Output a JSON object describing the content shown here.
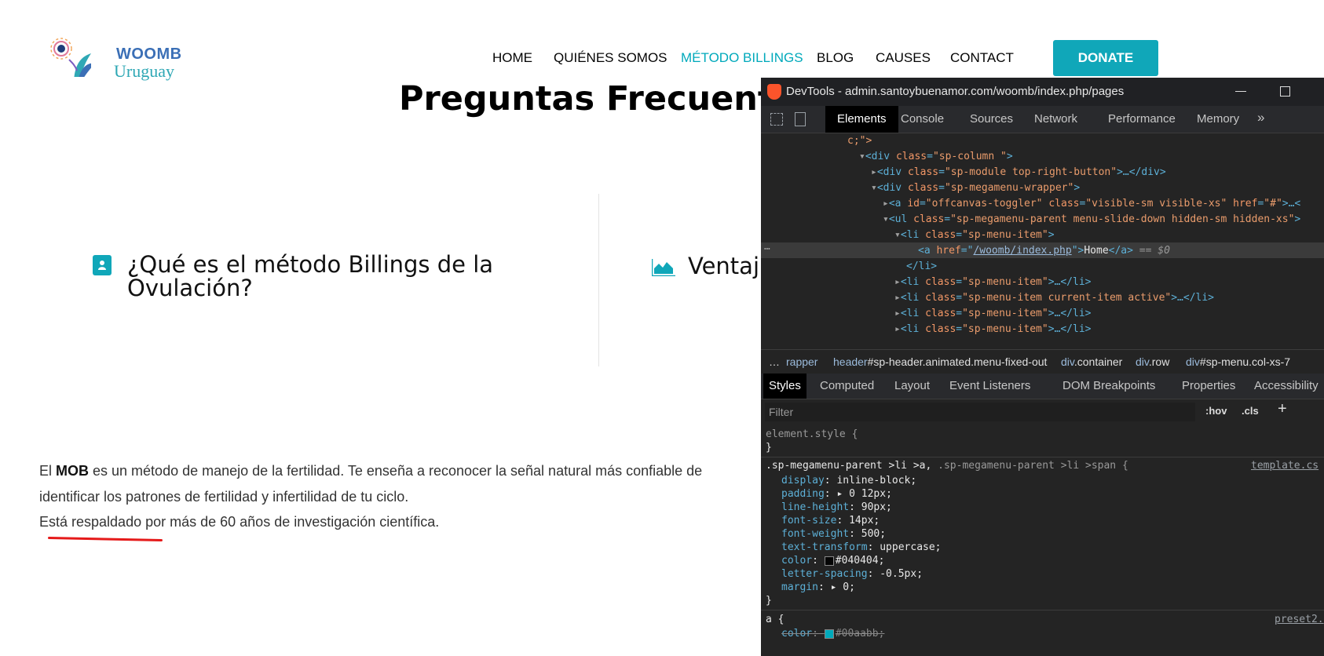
{
  "site": {
    "logo": {
      "line1": "WOOMB",
      "line2": "Uruguay"
    },
    "nav": [
      "HOME",
      "QUIÉNES SOMOS",
      "MÉTODO BILLINGS",
      "BLOG",
      "CAUSES",
      "CONTACT"
    ],
    "donate": "DONATE",
    "page_title": "Preguntas Frecuentes",
    "faq": [
      {
        "line1": "¿Qué es el método Billings de la",
        "line2": "Ovulación?"
      },
      {
        "line1": "Ventaj"
      }
    ],
    "paragraph": {
      "line1_a": "El ",
      "line1_bold": "MOB",
      "line1_b": " es un método de manejo de la fertilidad. Te enseña a reconocer la señal natural más confiable de",
      "line2": "identificar los patrones de fertilidad y infertilidad de tu ciclo.",
      "line3": "Está respaldado por más de 60 años de investigación científica."
    },
    "colors": {
      "accent": "#00a9bb",
      "donate_bg": "#10a7b9"
    }
  },
  "devtools": {
    "title": "DevTools - admin.santoybuenamor.com/woomb/index.php/pages",
    "tabs": [
      "Elements",
      "Console",
      "Sources",
      "Network",
      "Performance",
      "Memory"
    ],
    "more": "»",
    "dom": {
      "l0": "c;\">",
      "l1_tag": "<div ",
      "l1_attr": "class",
      "l1_val": "\"sp-column \"",
      "l1_end": ">",
      "l2_tag": "<div ",
      "l2_attr": "class",
      "l2_val": "\"sp-module top-right-button\"",
      "l2_end": ">…</div>",
      "l3_tag": "<div ",
      "l3_attr": "class",
      "l3_val": "\"sp-megamenu-wrapper\"",
      "l3_end": ">",
      "l4_tag": "<a ",
      "l4_attr": "id",
      "l4_val": "\"offcanvas-toggler\"",
      "l4_attr2": " class",
      "l4_val2": "\"visible-sm visible-xs\"",
      "l4_attr3": " href",
      "l4_val3": "\"#\"",
      "l4_end": ">…<",
      "l5_tag": "<ul ",
      "l5_attr": "class",
      "l5_val": "\"sp-megamenu-parent menu-slide-down hidden-sm hidden-xs\"",
      "l5_end": ">",
      "l6_tag": "<li ",
      "l6_attr": "class",
      "l6_val": "\"sp-menu-item\"",
      "l6_end": ">",
      "l7_tag": "<a ",
      "l7_attr": "href",
      "l7_q1": "=\"",
      "l7_link": "/woomb/index.php",
      "l7_q2": "\">",
      "l7_text": "Home",
      "l7_end": "</a>",
      "l7_eq": " == $0",
      "l8": "</li>",
      "l9_val": "\"sp-menu-item\"",
      "l9_end": ">…</li>",
      "l10_val": "\"sp-menu-item current-item active\"",
      "l10_end": ">…</li>",
      "l11_val": "\"sp-menu-item\"",
      "l11_end": ">…</li>",
      "l12_val": "\"sp-menu-item\"",
      "l12_end": ">…</li>"
    },
    "breadcrumbs": {
      "dots": "…",
      "c1": "rapper",
      "c2_tag": "header",
      "c2_rest": "#sp-header.animated.menu-fixed-out",
      "c3_tag": "div",
      "c3_rest": ".container",
      "c4_tag": "div",
      "c4_rest": ".row",
      "c5_tag": "div",
      "c5_rest": "#sp-menu.col-xs-7"
    },
    "style_tabs": [
      "Styles",
      "Computed",
      "Layout",
      "Event Listeners",
      "DOM Breakpoints",
      "Properties",
      "Accessibility"
    ],
    "filter_placeholder": "Filter",
    "hov": ":hov",
    "cls": ".cls",
    "plus": "+",
    "styles": {
      "element_style": "element.style {",
      "close": "}",
      "rule_sel_a": ".sp-megamenu-parent >li >a, ",
      "rule_sel_b": ".sp-megamenu-parent >li >span {",
      "rule_src": "template.cs",
      "decls": [
        {
          "p": "display",
          "v": "inline-block;"
        },
        {
          "p": "padding",
          "v": "▸ 0 12px;"
        },
        {
          "p": "line-height",
          "v": "90px;"
        },
        {
          "p": "font-size",
          "v": "14px;"
        },
        {
          "p": "font-weight",
          "v": "500;"
        },
        {
          "p": "text-transform",
          "v": "uppercase;"
        },
        {
          "p": "color",
          "v": "#040404;"
        },
        {
          "p": "letter-spacing",
          "v": "-0.5px;"
        },
        {
          "p": "margin",
          "v": "▸ 0;"
        }
      ],
      "a_sel": "a {",
      "a_src": "preset2.",
      "a_decl_p": "color",
      "a_decl_v": "#00aabb;",
      "color_swatch": "#040404",
      "a_swatch": "#00aabb"
    }
  }
}
